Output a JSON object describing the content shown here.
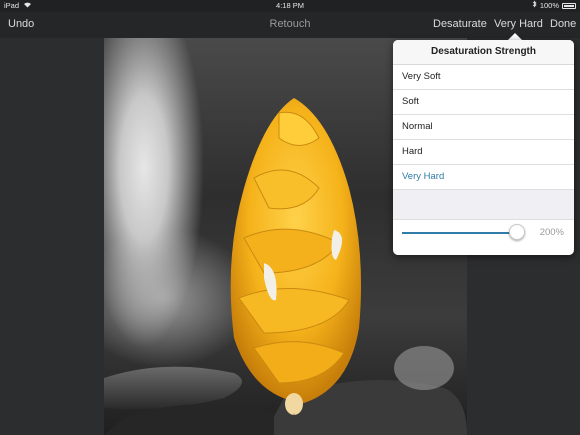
{
  "statusbar": {
    "device": "iPad",
    "time": "4:18 PM",
    "battery": "100%"
  },
  "toolbar": {
    "undo_label": "Undo",
    "title": "Retouch",
    "desaturate_label": "Desaturate",
    "strength_label": "Very Hard",
    "done_label": "Done"
  },
  "popover": {
    "title": "Desaturation Strength",
    "options": [
      "Very Soft",
      "Soft",
      "Normal",
      "Hard",
      "Very Hard"
    ],
    "selected": "Very Hard",
    "slider_value": "200%",
    "slider_fraction": 1.0,
    "accent_color": "#2f7ca8"
  },
  "photo": {
    "subject": "yellow-flower-desaturated-background"
  }
}
